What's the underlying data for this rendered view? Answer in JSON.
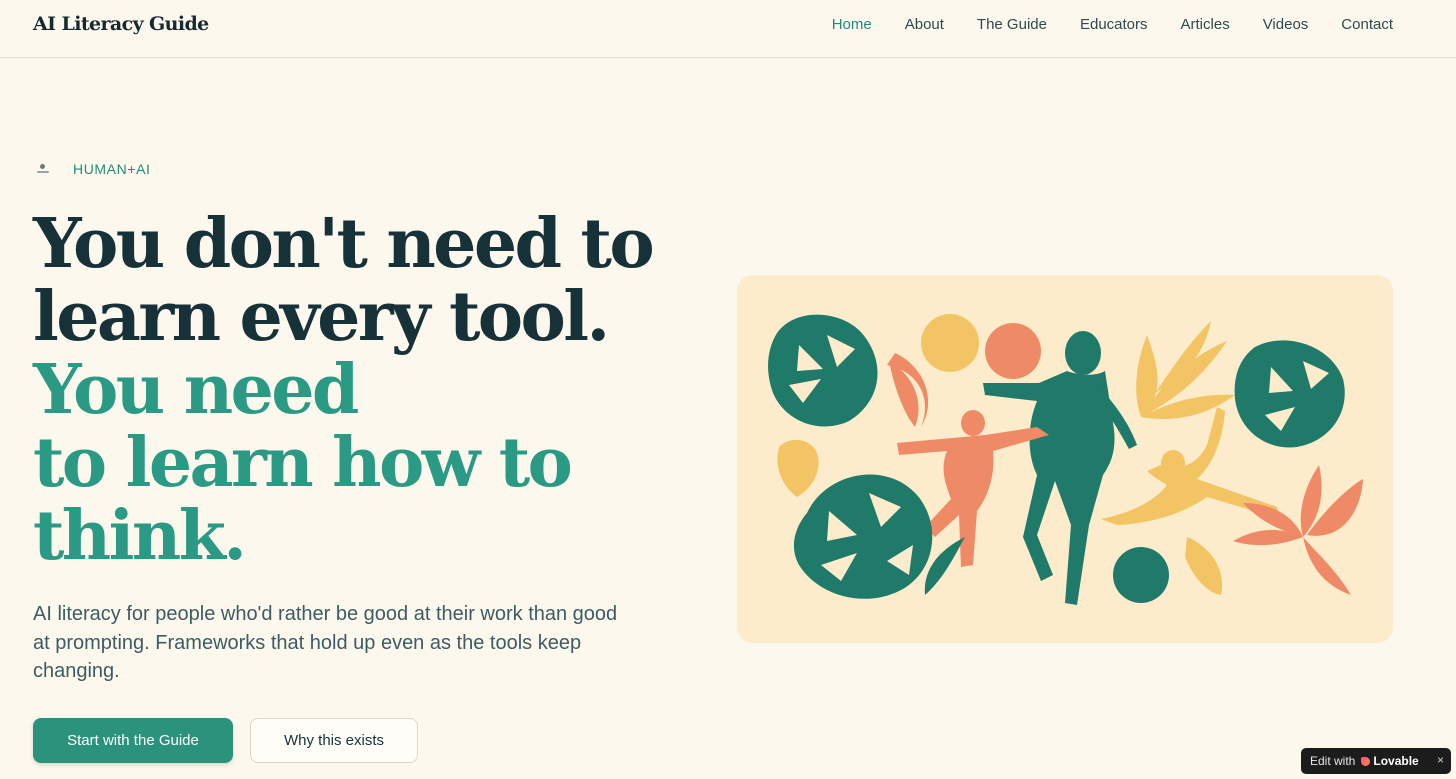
{
  "header": {
    "brand": "AI Literacy Guide",
    "nav": [
      "Home",
      "About",
      "The Guide",
      "Educators",
      "Articles",
      "Videos",
      "Contact"
    ],
    "active": "Home"
  },
  "hero": {
    "eyebrow": "HUMAN+AI",
    "headline_line1": "You don't need to",
    "headline_line2": "learn every tool.",
    "headline_line3": "You need",
    "headline_line4": "to learn how to",
    "headline_line5": "think.",
    "lead": "AI literacy for people who'd rather be good at their work than good at prompting. Frameworks that hold up even as the tools keep changing.",
    "primary_button": "Start with the Guide",
    "secondary_button": "Why this exists"
  },
  "badge": {
    "edit_label": "Edit with",
    "brand": "Lovable",
    "close": "×"
  },
  "colors": {
    "background": "#fdf8ee",
    "accent": "#2b9a84",
    "dark_text": "#163238",
    "illustration_green": "#1f7a69",
    "illustration_coral": "#ef8a66",
    "illustration_yellow": "#f2c463",
    "illustration_bg": "#fdeccb"
  },
  "icons": {
    "eyebrow": "human-ai-icon",
    "badge_logo": "lovable-heart-icon",
    "badge_close": "close-icon"
  }
}
